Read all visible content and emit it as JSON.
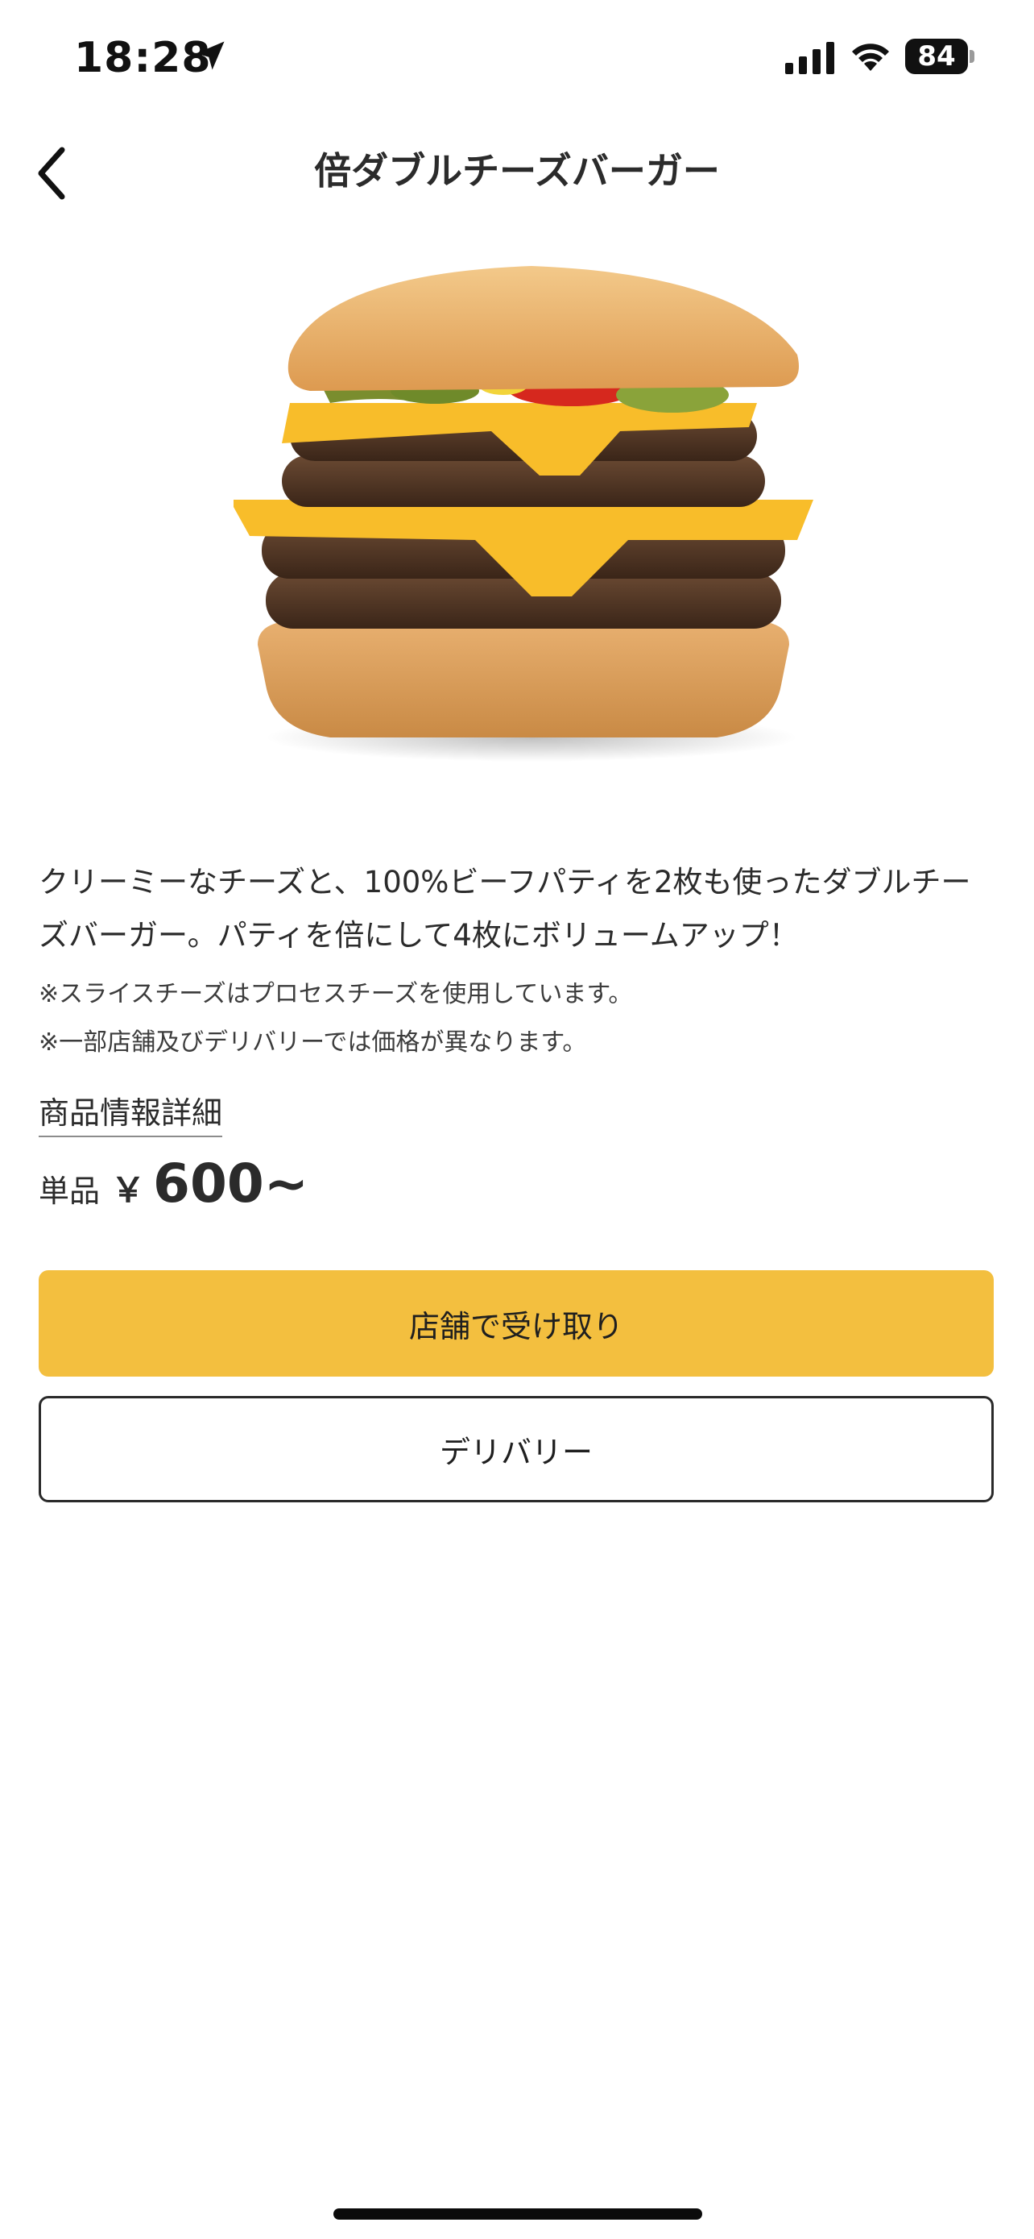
{
  "status_bar": {
    "time": "18:28",
    "battery": "84",
    "icons": [
      "location-arrow-icon",
      "cellular-signal-icon",
      "wifi-icon",
      "battery-icon"
    ]
  },
  "header": {
    "title": "倍ダブルチーズバーガー",
    "back_icon": "chevron-left-icon"
  },
  "product": {
    "image": "burger-image",
    "description": "クリーミーなチーズと、100%ビーフパティを2枚も使ったダブルチーズバーガー。パティを倍にして4枚にボリュームアップ！",
    "notes": [
      "※スライスチーズはプロセスチーズを使用しています。",
      "※一部店舗及びデリバリーでは価格が異なります。"
    ],
    "detail_link": "商品情報詳細",
    "price": {
      "label": "単品",
      "currency": "￥",
      "value": "600~"
    }
  },
  "actions": {
    "pickup_label": "店舗で受け取り",
    "delivery_label": "デリバリー"
  },
  "colors": {
    "accent": "#f3bf3f",
    "text": "#2b2b2b",
    "background": "#ffffff"
  }
}
